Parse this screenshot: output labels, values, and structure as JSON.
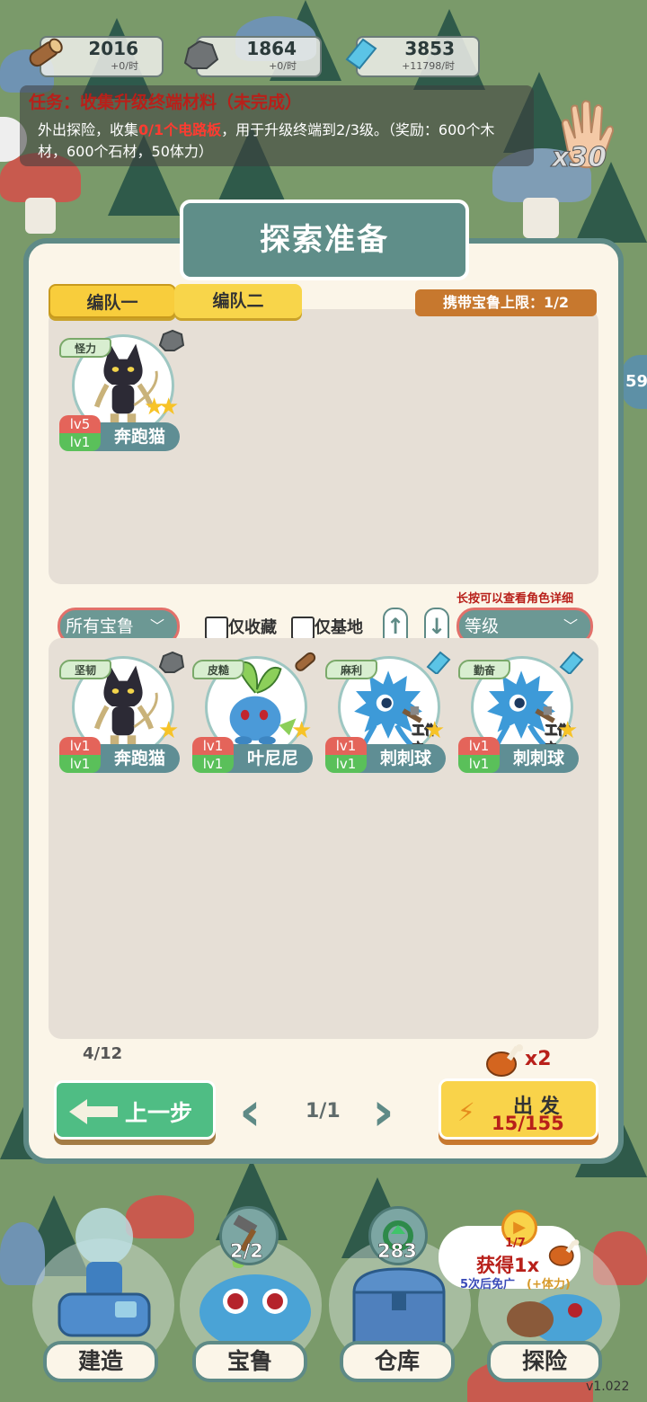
{
  "resources": [
    {
      "name": "wood",
      "icon": "log-icon",
      "value": "2016",
      "rate": "+0/时"
    },
    {
      "name": "stone",
      "icon": "stone-icon",
      "value": "1864",
      "rate": "+0/时"
    },
    {
      "name": "crystal",
      "icon": "crystal-icon",
      "value": "3853",
      "rate": "+11798/时"
    }
  ],
  "quest": {
    "title": "任务：收集升级终端材料（未完成）",
    "desc_pre": "外出探险，收集",
    "desc_highlight": "0/1个电路板",
    "desc_post": "，用于升级终端到2/3级。（奖励：600个木材，600个石材，50体力）"
  },
  "side_hand": {
    "count": "x30"
  },
  "panel": {
    "title": "探索准备",
    "tabs": [
      "编队一",
      "编队二"
    ],
    "active_tab": 0,
    "carry_limit": "携带宝鲁上限：1/2"
  },
  "team": [
    {
      "name": "奔跑猫",
      "trait": "怪力",
      "lv_top": "lv5",
      "lv_bot": "lv1",
      "stars": 2,
      "resource": "stone-icon"
    }
  ],
  "filters": {
    "category": "所有宝鲁",
    "fav_label": "仅收藏",
    "base_label": "仅基地",
    "sort_up": "↑",
    "sort_down": "↓",
    "sort": "等级",
    "hint": "长按可以查看角色详细"
  },
  "roster": [
    {
      "name": "奔跑猫",
      "trait": "坚韧",
      "lv_top": "lv1",
      "lv_bot": "lv1",
      "stars": 1,
      "resource": "stone-icon",
      "working": ""
    },
    {
      "name": "叶尼尼",
      "trait": "皮糙",
      "lv_top": "lv1",
      "lv_bot": "lv1",
      "stars": 1,
      "resource": "log-icon",
      "working": ""
    },
    {
      "name": "刺刺球",
      "trait": "麻利",
      "lv_top": "lv1",
      "lv_bot": "lv1",
      "stars": 1,
      "resource": "crystal-icon",
      "working": "工作中"
    },
    {
      "name": "刺刺球",
      "trait": "勤奋",
      "lv_top": "lv1",
      "lv_bot": "lv1",
      "stars": 1,
      "resource": "crystal-icon",
      "working": "工作中"
    }
  ],
  "footer": {
    "count": "4/12",
    "back_label": "上一步",
    "page": "1/1",
    "meat_count": "x2",
    "go_label": "出 发",
    "stamina": "15/155"
  },
  "nav": {
    "items": [
      {
        "label": "建造",
        "badge": ""
      },
      {
        "label": "宝鲁",
        "badge": "2/2"
      },
      {
        "label": "仓库",
        "badge": "283"
      },
      {
        "label": "探险",
        "badge": ""
      }
    ],
    "ad": {
      "progress": "1/7",
      "reward": "获得1x",
      "free_text": "5次后免广",
      "stamina_text": "(+体力)"
    }
  },
  "version": "v1.022",
  "side_number": "59",
  "colors": {
    "accent": "#5e8a86",
    "panel": "#fbf5e8",
    "danger": "#b8201a",
    "yellow": "#f9d34a",
    "green": "#4fbd84"
  }
}
